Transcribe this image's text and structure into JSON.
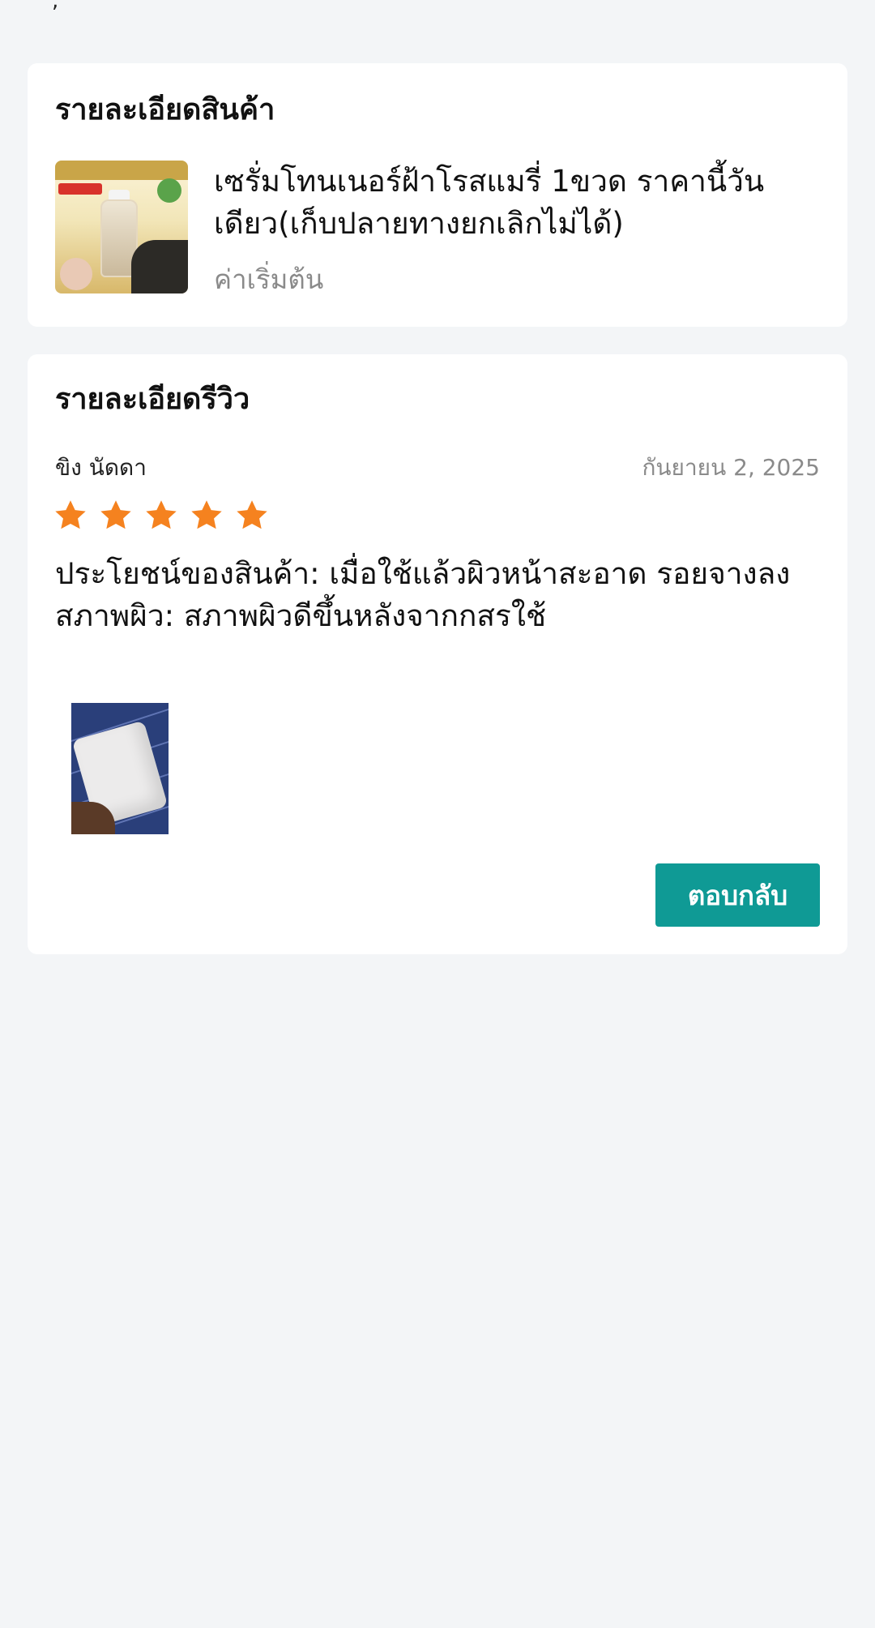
{
  "product_section": {
    "title": "รายละเอียดสินค้า",
    "product_name": "เซรั่มโทนเนอร์ฝ้าโรสแมรี่ 1ขวด ราคานี้วันเดียว(เก็บปลายทางยกเลิกไม่ได้)",
    "variation": "ค่าเริ่มต้น"
  },
  "review_section": {
    "title": "รายละเอียดรีวิว",
    "reviewer": "ขิง นัดดา",
    "date": "กันยายน 2, 2025",
    "rating": 5,
    "star_color": "#f5821f",
    "benefit_line": "ประโยชน์ของสินค้า: เมื่อใช้แล้วผิวหน้าสะอาด รอยจางลง",
    "skin_line": "สภาพผิว: สภาพผิวดีขึ้นหลังจากกสรใช้",
    "reply_label": "ตอบกลับ",
    "accent_color": "#0f9a95"
  }
}
